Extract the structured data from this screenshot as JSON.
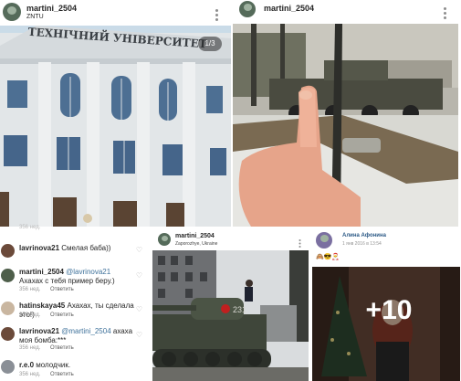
{
  "post1": {
    "username": "martini_2504",
    "location": "ZNTU",
    "building_sign": "ТЕХНІЧНИЙ УНІВЕРСИТЕТ",
    "carousel_counter": "1/3",
    "cutoff_meta": "356 нед."
  },
  "post2": {
    "username": "martini_2504"
  },
  "comments": [
    {
      "user": "lavrinova21",
      "text": "Смелая баба))",
      "meta": "",
      "reply": ""
    },
    {
      "user": "martini_2504",
      "mention": "@lavrinova21",
      "text": " Ахахах с тебя пример беру.)",
      "meta": "356 нед.",
      "reply": "Ответить"
    },
    {
      "user": "hatinskaya45",
      "text": "Ахахах, ты сделала это!)",
      "meta": "356 нед.",
      "reply": "Ответить"
    },
    {
      "user": "lavrinova21",
      "mention": "@martini_2504",
      "text": " ахаха моя бомба:***",
      "meta": "356 нед.",
      "reply": "Ответить"
    },
    {
      "user": "r.e.0",
      "text": " молодчик.",
      "meta": "356 нед.",
      "reply": "Ответить"
    }
  ],
  "post3": {
    "username": "martini_2504",
    "location": "Zaporozhye, Ukraine",
    "tank_number": "231"
  },
  "post4": {
    "username": "Алина Афонина",
    "date": "1 янв 2016 в 13:54",
    "emoji": "🙈😎🎅",
    "overlay_count": "+10"
  }
}
